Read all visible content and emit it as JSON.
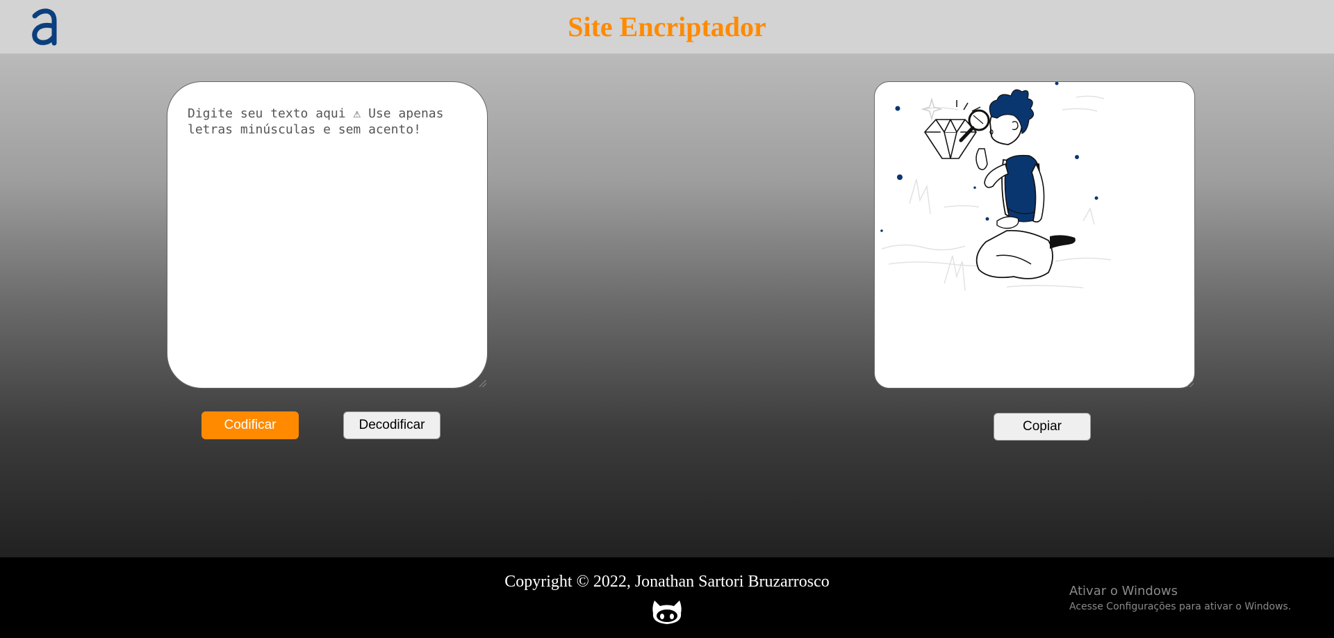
{
  "header": {
    "title": "Site Encriptador",
    "logo_icon": "alura-a-logo-icon"
  },
  "colors": {
    "accent": "#ff8a00",
    "header_bg": "#d3d3d3",
    "logo": "#0b3f7e",
    "illustration_blue": "#0a3670"
  },
  "input": {
    "placeholder": "Digite seu texto aqui ⚠ Use apenas letras minúsculas e sem acento!",
    "value": ""
  },
  "buttons": {
    "encrypt": "Codificar",
    "decrypt": "Decodificar",
    "copy": "Copiar"
  },
  "output": {
    "illustration_icon": "person-searching-diamond-illustration"
  },
  "footer": {
    "copyright": "Copyright © 2022, Jonathan Sartori Bruzarrosco",
    "github_icon": "github-octocat-icon"
  },
  "watermark": {
    "title": "Ativar o Windows",
    "subtitle": "Acesse Configurações para ativar o Windows."
  }
}
